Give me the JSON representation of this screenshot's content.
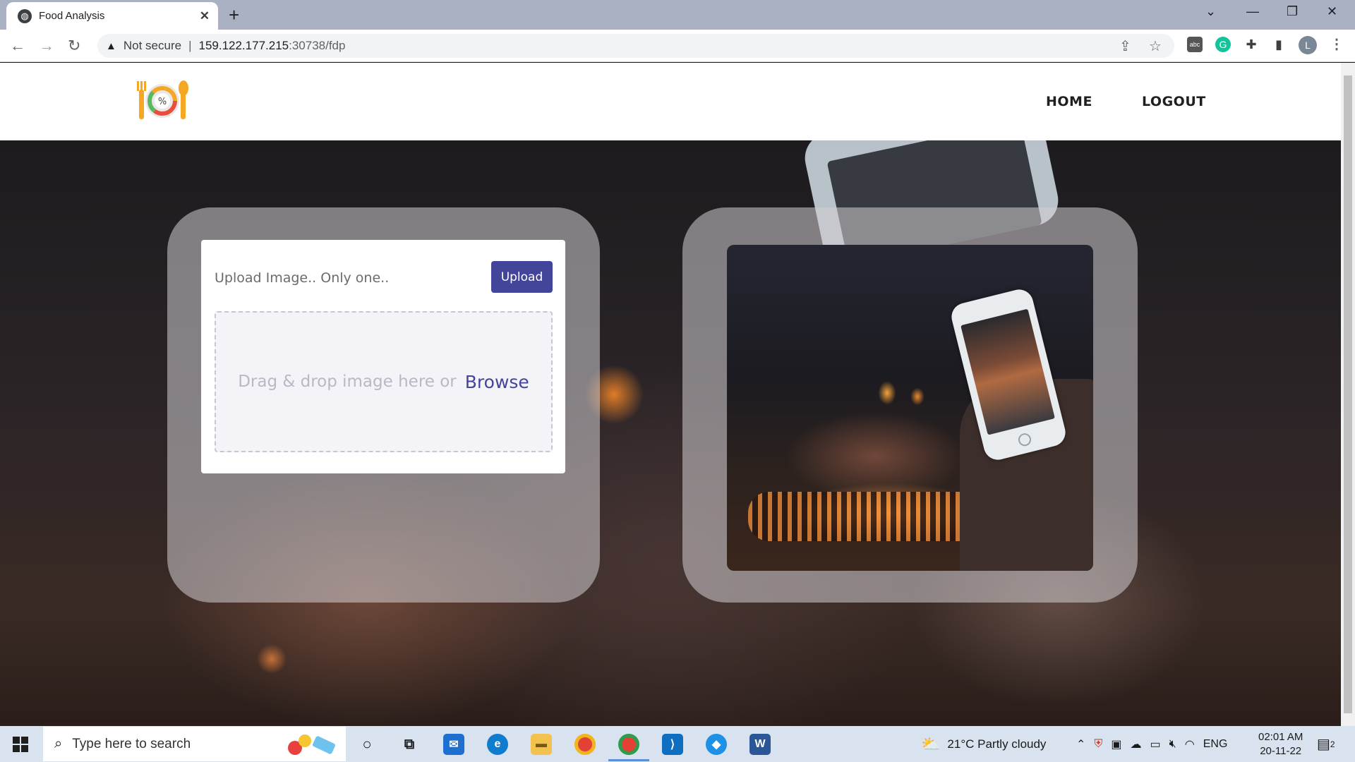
{
  "browser": {
    "tab_title": "Food Analysis",
    "new_tab_symbol": "+",
    "close_tab_symbol": "✕",
    "security_label": "Not secure",
    "url_host": "159.122.177.215",
    "url_path": ":30738/fdp",
    "profile_initial": "L"
  },
  "nav": {
    "home": "HOME",
    "logout": "LOGOUT"
  },
  "upload": {
    "title": "Upload Image.. Only one..",
    "button_label": "Upload",
    "drop_text": "Drag & drop image here or",
    "browse_label": "Browse"
  },
  "taskbar": {
    "search_placeholder": "Type here to search",
    "weather": "21°C  Partly cloudy",
    "language": "ENG",
    "time": "02:01 AM",
    "date": "20-11-22",
    "notification_count": "2"
  },
  "colors": {
    "primary": "#43459b",
    "tabbar": "#aab1c3",
    "taskbar": "#d9e3ef"
  }
}
